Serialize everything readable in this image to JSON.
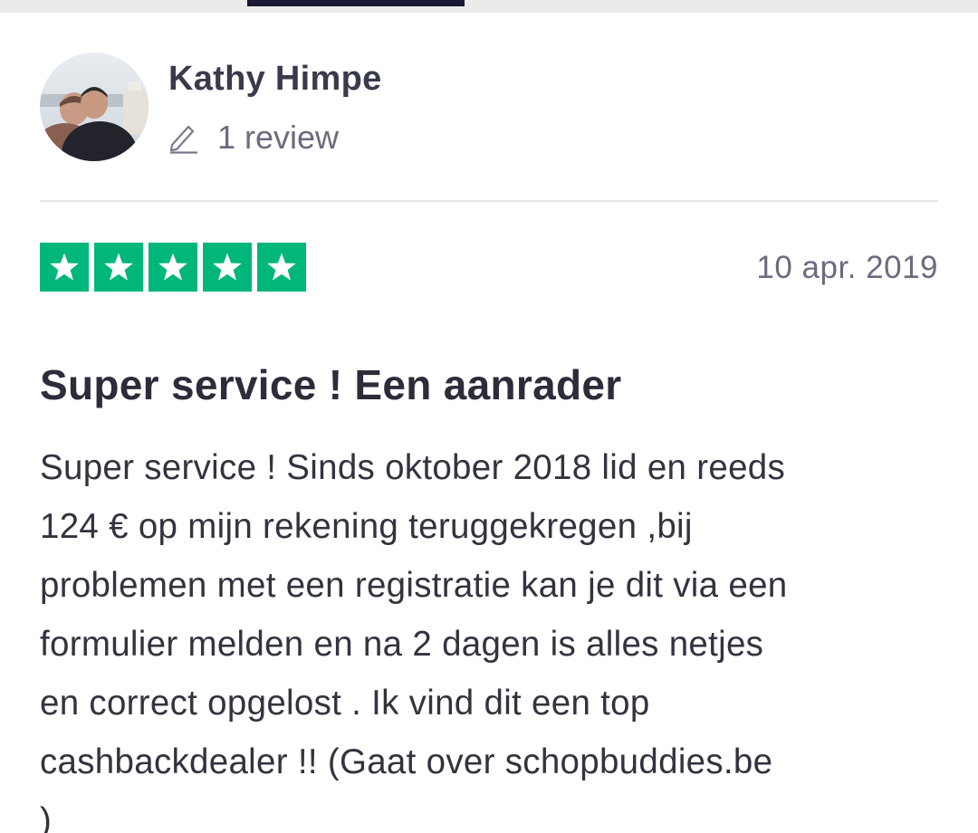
{
  "reviewer": {
    "name": "Kathy Himpe",
    "review_count": "1 review",
    "avatar_icon": "profile-photo"
  },
  "review": {
    "rating": 5,
    "max_rating": 5,
    "date": "10 apr. 2019",
    "title": "Super service ! Een aanrader",
    "body_lines": [
      "Super service ! Sinds oktober 2018 lid en reeds",
      "124 € op mijn rekening teruggekregen ,bij",
      "problemen met een registratie kan je dit via een",
      "formulier melden en na 2 dagen is alles netjes",
      "en correct opgelost . Ik vind dit een top",
      "cashbackdealer !! (Gaat over schopbuddies.be",
      ")"
    ]
  },
  "colors": {
    "star_green": "#00b67a",
    "tab_indicator": "#191934",
    "text_dark": "#2c2c3a",
    "text_muted": "#6b6b7e"
  }
}
